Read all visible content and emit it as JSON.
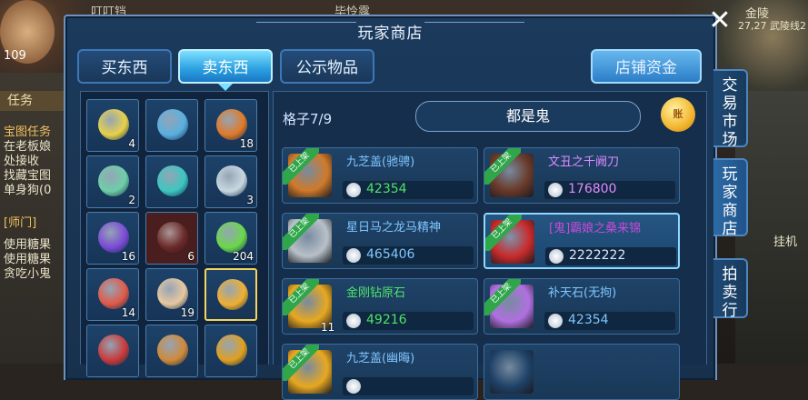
{
  "background": {
    "top_left_text": "叮叮铛",
    "top_mid_text": "毕怜露",
    "top_right_text": "金陵",
    "top_right_sub": "27,27 武陵线2",
    "level": "109",
    "left_tab": "任务",
    "left_lines": [
      "宝图任务",
      "在老板娘",
      "处接收",
      "找藏宝图",
      "单身狗(0"
    ],
    "left_tab2": "[师门]",
    "left_lines2": [
      "使用糖果",
      "使用糖果",
      "贪吃小鬼"
    ],
    "right_label": "挂机"
  },
  "panel": {
    "title": "玩家商店",
    "close_icon": "✕"
  },
  "tabs": {
    "buy": "买东西",
    "sell": "卖东西",
    "public": "公示物品",
    "funds": "店铺资金"
  },
  "market": {
    "grid_label": "格子7/9",
    "shop_name": "都是鬼",
    "coin_label": "账"
  },
  "inventory": [
    {
      "count": "4",
      "color": "#e8d24a"
    },
    {
      "count": "",
      "color": "#5ab0e0"
    },
    {
      "count": "18",
      "color": "#e07a2a"
    },
    {
      "count": "2",
      "color": "#6ecfa8"
    },
    {
      "count": "",
      "color": "#3cc7c0"
    },
    {
      "count": "3",
      "color": "#c8d8e0"
    },
    {
      "count": "16",
      "color": "#7b4ad6"
    },
    {
      "count": "6",
      "color": "#6a2a2a"
    },
    {
      "count": "204",
      "color": "#6bd84a"
    },
    {
      "count": "14",
      "color": "#e05a4a"
    },
    {
      "count": "19",
      "color": "#e8c8a0"
    },
    {
      "count": "",
      "color": "#f0b030"
    },
    {
      "count": "",
      "color": "#c83a3a"
    },
    {
      "count": "",
      "color": "#d08a3a"
    },
    {
      "count": "",
      "color": "#e0a020"
    }
  ],
  "items": [
    {
      "ribbon": "已上架",
      "name": "九芝盖(驰骋)",
      "name_color": "#7fc6ff",
      "price": "42354",
      "price_color": "#4ee36a",
      "qty": "",
      "pic_color": "#d07a2a"
    },
    {
      "ribbon": "已上架",
      "name": "文丑之千阙刀",
      "name_color": "#e08bff",
      "price": "176800",
      "price_color": "#e08bff",
      "qty": "",
      "pic_color": "#6a3a2a"
    },
    {
      "ribbon": "已上架",
      "name": "星日马之龙马精神",
      "name_color": "#7fc6ff",
      "price": "465406",
      "price_color": "#7fc6ff",
      "qty": "",
      "pic_color": "#b8c0c8"
    },
    {
      "ribbon": "已上架",
      "name": "[鬼]霸娘之桑来锦",
      "name_color": "#c84ad8",
      "price": "2222222",
      "price_color": "#dde8ff",
      "qty": "",
      "pic_color": "#c82a2a"
    },
    {
      "ribbon": "已上架",
      "name": "金刚钻原石",
      "name_color": "#4ee36a",
      "price": "49216",
      "price_color": "#4ee36a",
      "qty": "11",
      "pic_color": "#e8a820"
    },
    {
      "ribbon": "已上架",
      "name": "补天石(无拘)",
      "name_color": "#7fc6ff",
      "price": "42354",
      "price_color": "#7fc6ff",
      "qty": "",
      "pic_color": "#b070e0"
    },
    {
      "ribbon": "已上架",
      "name": "九芝盖(幽晦)",
      "name_color": "#7fc6ff",
      "price": "",
      "price_color": "#4ee36a",
      "qty": "",
      "pic_color": "#e8a820"
    },
    {
      "ribbon": "",
      "name": "",
      "name_color": "#7fc6ff",
      "price": "",
      "price_color": "#4ee36a",
      "qty": "",
      "pic_color": "#1f4268"
    }
  ],
  "side_tabs": [
    "交易市场",
    "玩家商店",
    "拍卖行"
  ]
}
